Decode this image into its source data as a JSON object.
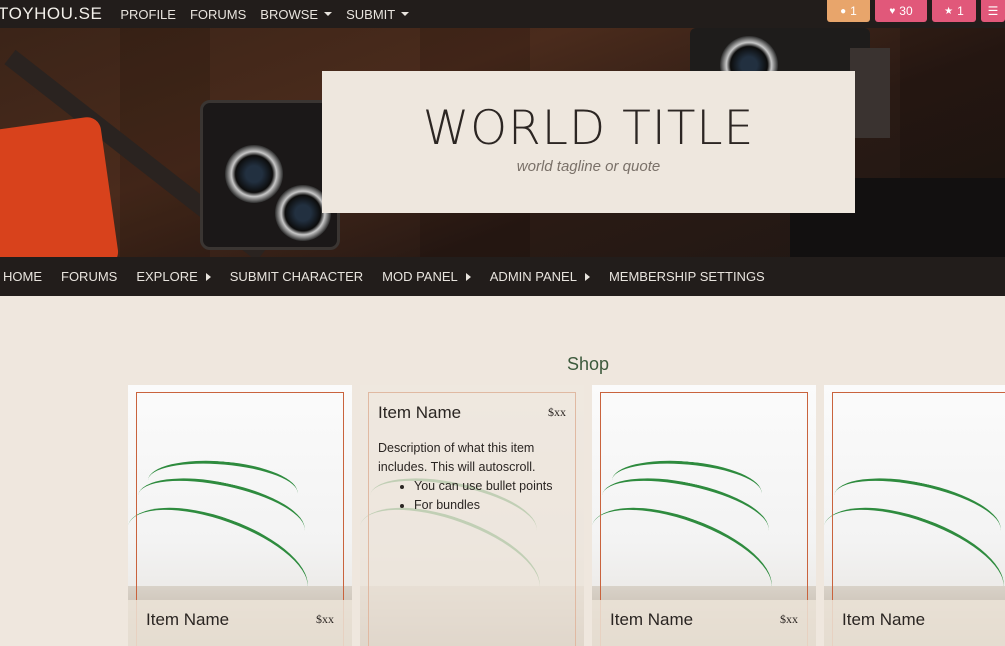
{
  "site": {
    "brand": "TOYHOU.SE",
    "nav": [
      {
        "label": "PROFILE",
        "dropdown": false
      },
      {
        "label": "FORUMS",
        "dropdown": false
      },
      {
        "label": "BROWSE",
        "dropdown": true
      },
      {
        "label": "SUBMIT",
        "dropdown": true
      }
    ],
    "badges": [
      {
        "icon": "notification-dot-icon",
        "glyph": "●",
        "count": "1",
        "color": "#e8a56b"
      },
      {
        "icon": "heart-icon",
        "glyph": "♥",
        "count": "30",
        "color": "#e1587a"
      },
      {
        "icon": "star-icon",
        "glyph": "★",
        "count": "1",
        "color": "#e1587a"
      },
      {
        "icon": "menu-icon",
        "glyph": "☰",
        "count": "",
        "color": "#e1587a"
      }
    ]
  },
  "banner": {
    "title": "WORLD TITLE",
    "tagline": "world tagline or quote"
  },
  "world_nav": [
    {
      "label": "HOME",
      "submenu": false
    },
    {
      "label": "FORUMS",
      "submenu": false
    },
    {
      "label": "EXPLORE",
      "submenu": true
    },
    {
      "label": "SUBMIT CHARACTER",
      "submenu": false
    },
    {
      "label": "MOD PANEL",
      "submenu": true
    },
    {
      "label": "ADMIN PANEL",
      "submenu": true
    },
    {
      "label": "MEMBERSHIP SETTINGS",
      "submenu": false
    }
  ],
  "shop": {
    "title": "Shop",
    "items": [
      {
        "name": "Item Name",
        "price": "$xx"
      },
      {
        "name": "Item Name",
        "price": "$xx",
        "description": "Description of what this item includes. This will autoscroll.",
        "bullets": [
          "You can use bullet points",
          "For bundles"
        ]
      },
      {
        "name": "Item Name",
        "price": "$xx"
      },
      {
        "name": "Item Name",
        "price": ""
      }
    ]
  }
}
